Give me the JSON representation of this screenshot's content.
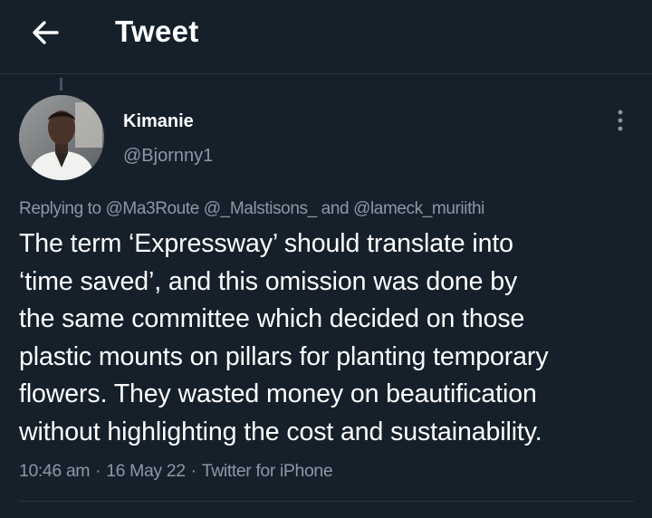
{
  "header": {
    "title": "Tweet",
    "back_icon": "arrow-left-icon"
  },
  "author": {
    "name": "Kimanie",
    "handle": "@Bjornny1",
    "avatar_icon": "user-avatar"
  },
  "more_icon": "vertical-ellipsis-icon",
  "reply": {
    "prefix": "Replying to",
    "mentions": [
      "@Ma3Route",
      "@_Malstisons_",
      "@lameck_muriithi"
    ],
    "conjunction": "and"
  },
  "tweet": {
    "text": "The term ‘Expressway’ should translate into\n‘time saved’, and this omission was done by\nthe same committee which decided on those\nplastic mounts on pillars for planting temporary\nflowers. They wasted money on beautification\nwithout highlighting the cost and sustainability."
  },
  "meta": {
    "time": "10:46 am",
    "date": "16 May 22",
    "source": "Twitter for iPhone",
    "separator": "·"
  },
  "colors": {
    "background": "#15202b",
    "text": "#ffffff",
    "secondary": "#8b98a5",
    "divider": "#2a3743"
  }
}
